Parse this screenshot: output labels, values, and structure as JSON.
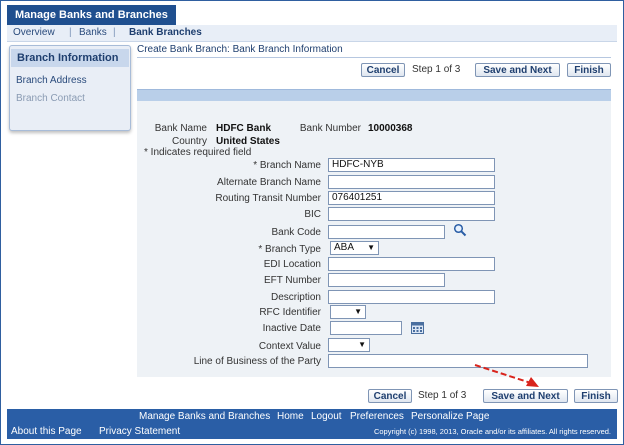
{
  "app": {
    "title": "Manage Banks and Branches"
  },
  "nav": {
    "overview": "Overview",
    "separator": "|",
    "banks": "Banks",
    "branches": "Bank Branches"
  },
  "sidebar": {
    "active": "Branch Information",
    "items": [
      {
        "label": "Branch Address"
      },
      {
        "label": "Branch Contact"
      }
    ]
  },
  "header": {
    "title": "Create Bank Branch: Bank Branch Information"
  },
  "buttons": {
    "cancel": "Cancel",
    "step": "Step 1 of 3",
    "save_next": "Save and Next",
    "finish": "Finish"
  },
  "bank_info": {
    "bank_name_label": "Bank Name",
    "bank_name": "HDFC Bank",
    "bank_number_label": "Bank Number",
    "bank_number": "10000368",
    "country_label": "Country",
    "country": "United States",
    "required_note": "* Indicates required field"
  },
  "fields": {
    "branch_name": {
      "label": "* Branch Name",
      "value": "HDFC-NYB"
    },
    "alternate_branch_name": {
      "label": "Alternate Branch Name",
      "value": ""
    },
    "routing_transit_number": {
      "label": "Routing Transit Number",
      "value": "076401251"
    },
    "bic": {
      "label": "BIC",
      "value": ""
    },
    "bank_code": {
      "label": "Bank Code",
      "value": ""
    },
    "branch_type": {
      "label": "* Branch Type",
      "value": "ABA"
    },
    "edi_location": {
      "label": "EDI Location",
      "value": ""
    },
    "eft_number": {
      "label": "EFT Number",
      "value": ""
    },
    "description": {
      "label": "Description",
      "value": ""
    },
    "rfc_identifier": {
      "label": "RFC Identifier",
      "value": ""
    },
    "inactive_date": {
      "label": "Inactive Date",
      "value": ""
    },
    "context_value": {
      "label": "Context Value",
      "value": ""
    },
    "line_of_business": {
      "label": "Line of Business of the Party",
      "value": ""
    }
  },
  "footer": {
    "links": [
      "Manage Banks and Branches",
      "Home",
      "Logout",
      "Preferences",
      "Personalize Page"
    ],
    "about": "About this Page",
    "privacy": "Privacy Statement",
    "copyright": "Copyright (c) 1998, 2013, Oracle and/or its affiliates. All rights reserved."
  },
  "colors": {
    "brand_blue": "#2a5ea6",
    "accent_arrow": "#d9241c"
  }
}
